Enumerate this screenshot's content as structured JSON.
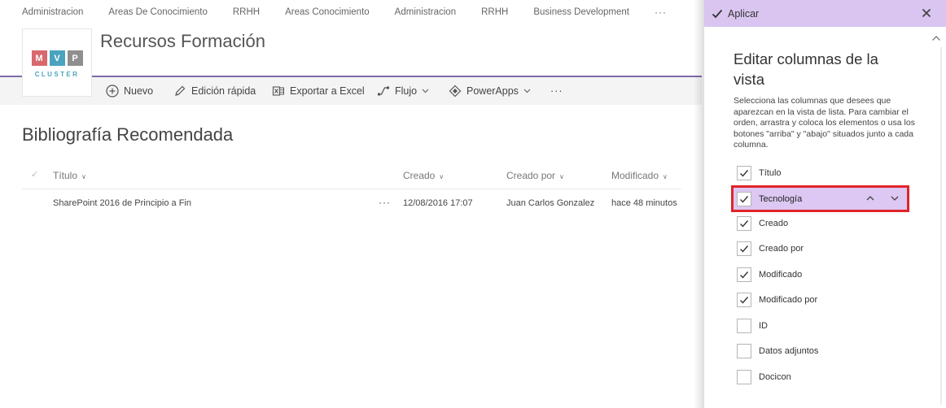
{
  "top_nav": {
    "items": [
      "Administracion",
      "Areas De Conocimiento",
      "RRHH",
      "Areas Conocimiento",
      "Administracion",
      "RRHH",
      "Business Development"
    ],
    "more": "···"
  },
  "logo": {
    "letters": [
      "M",
      "V",
      "P"
    ],
    "tile_colors": [
      "#d9686e",
      "#4aa3bf",
      "#8f8f8f"
    ],
    "tagline": "CLUSTER"
  },
  "site": {
    "title": "Recursos Formación"
  },
  "command_bar": {
    "new_label": "Nuevo",
    "quick_edit_label": "Edición rápida",
    "export_label": "Exportar a Excel",
    "flow_label": "Flujo",
    "powerapps_label": "PowerApps",
    "more": "···"
  },
  "list": {
    "title": "Bibliografía Recomendada",
    "columns": [
      "Título",
      "Creado",
      "Creado por",
      "Modificado"
    ],
    "rows": [
      {
        "title": "SharePoint 2016 de Principio a Fin",
        "created": "12/08/2016 17:07",
        "created_by": "Juan Carlos Gonzalez",
        "modified": "hace 48 minutos"
      }
    ],
    "row_more": "···"
  },
  "panel": {
    "apply_label": "Aplicar",
    "heading": "Editar columnas de la vista",
    "description": "Selecciona las columnas que desees que aparezcan en la vista de lista. Para cambiar el orden, arrastra y coloca los elementos o usa los botones \"arriba\" y \"abajo\" situados junto a cada columna.",
    "columns": [
      {
        "label": "Título",
        "checked": true
      },
      {
        "label": "Tecnología",
        "checked": true
      },
      {
        "label": "Creado",
        "checked": true
      },
      {
        "label": "Creado por",
        "checked": true
      },
      {
        "label": "Modificado",
        "checked": true
      },
      {
        "label": "Modificado por",
        "checked": true
      },
      {
        "label": "ID",
        "checked": false
      },
      {
        "label": "Datos adjuntos",
        "checked": false
      },
      {
        "label": "Docicon",
        "checked": false
      }
    ]
  },
  "colors": {
    "panel_bar": "#d9c5f0",
    "highlight_row": "#dcc8f2",
    "highlight_outline": "#e0242c",
    "header_rule": "#7f6aa8"
  }
}
